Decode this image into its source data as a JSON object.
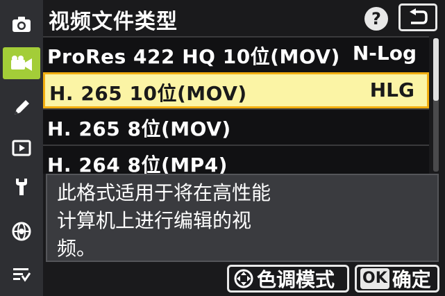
{
  "header": {
    "title": "视频文件类型",
    "help_label": "?"
  },
  "sidebar": {
    "items": [
      {
        "icon": "camera-icon"
      },
      {
        "icon": "video-camera-icon"
      },
      {
        "icon": "pencil-icon"
      },
      {
        "icon": "playback-icon"
      },
      {
        "icon": "wrench-icon"
      },
      {
        "icon": "network-icon"
      },
      {
        "icon": "my-menu-icon"
      }
    ]
  },
  "options": [
    {
      "name": "ProRes 422 HQ 10位(MOV)",
      "tag": "N-Log"
    },
    {
      "name": "H. 265 10位(MOV)",
      "tag": "HLG",
      "selected": true
    },
    {
      "name": "H. 265 8位(MOV)",
      "tag": ""
    },
    {
      "name": "H. 264 8位(MP4)",
      "tag": ""
    }
  ],
  "description": {
    "lines": [
      "此格式适用于将在高性能",
      "计算机上进行编辑的视",
      "频。"
    ]
  },
  "footer": {
    "tone_label": "色调模式",
    "ok_badge": "OK",
    "ok_label": "确定"
  },
  "colors": {
    "accent_green": "#a3cd38",
    "highlight": "#fbf4a5",
    "highlight_border": "#f2ae10"
  }
}
